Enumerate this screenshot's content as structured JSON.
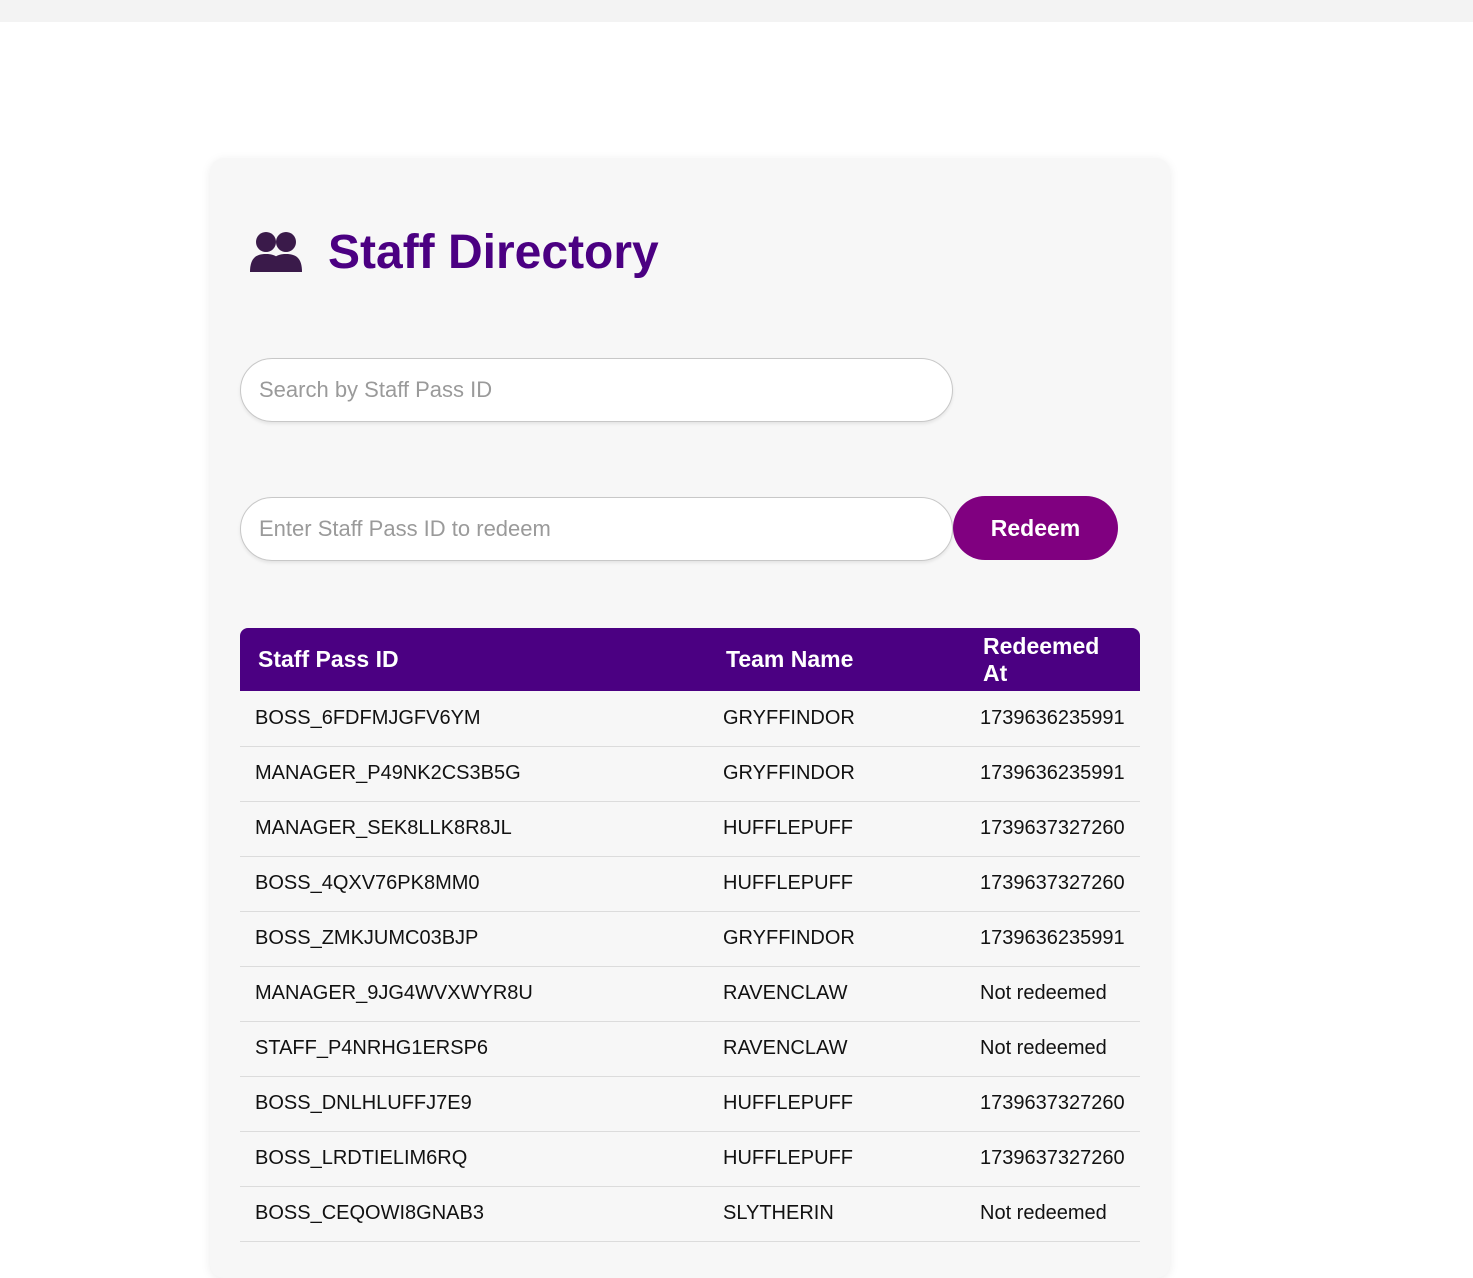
{
  "page": {
    "title": "Staff Directory",
    "title_icon": "people-icon",
    "accent_color": "#4b0082",
    "button_color": "#800080"
  },
  "search": {
    "placeholder": "Search by Staff Pass ID",
    "value": ""
  },
  "redeem": {
    "placeholder": "Enter Staff Pass ID to redeem",
    "value": "",
    "button_label": "Redeem"
  },
  "table": {
    "headers": [
      "Staff Pass ID",
      "Team Name",
      "Redeemed At"
    ],
    "rows": [
      [
        "BOSS_6FDFMJGFV6YM",
        "GRYFFINDOR",
        "1739636235991"
      ],
      [
        "MANAGER_P49NK2CS3B5G",
        "GRYFFINDOR",
        "1739636235991"
      ],
      [
        "MANAGER_SEK8LLK8R8JL",
        "HUFFLEPUFF",
        "1739637327260"
      ],
      [
        "BOSS_4QXV76PK8MM0",
        "HUFFLEPUFF",
        "1739637327260"
      ],
      [
        "BOSS_ZMKJUMC03BJP",
        "GRYFFINDOR",
        "1739636235991"
      ],
      [
        "MANAGER_9JG4WVXWYR8U",
        "RAVENCLAW",
        "Not redeemed"
      ],
      [
        "STAFF_P4NRHG1ERSP6",
        "RAVENCLAW",
        "Not redeemed"
      ],
      [
        "BOSS_DNLHLUFFJ7E9",
        "HUFFLEPUFF",
        "1739637327260"
      ],
      [
        "BOSS_LRDTIELIM6RQ",
        "HUFFLEPUFF",
        "1739637327260"
      ],
      [
        "BOSS_CEQOWI8GNAB3",
        "SLYTHERIN",
        "Not redeemed"
      ]
    ]
  }
}
